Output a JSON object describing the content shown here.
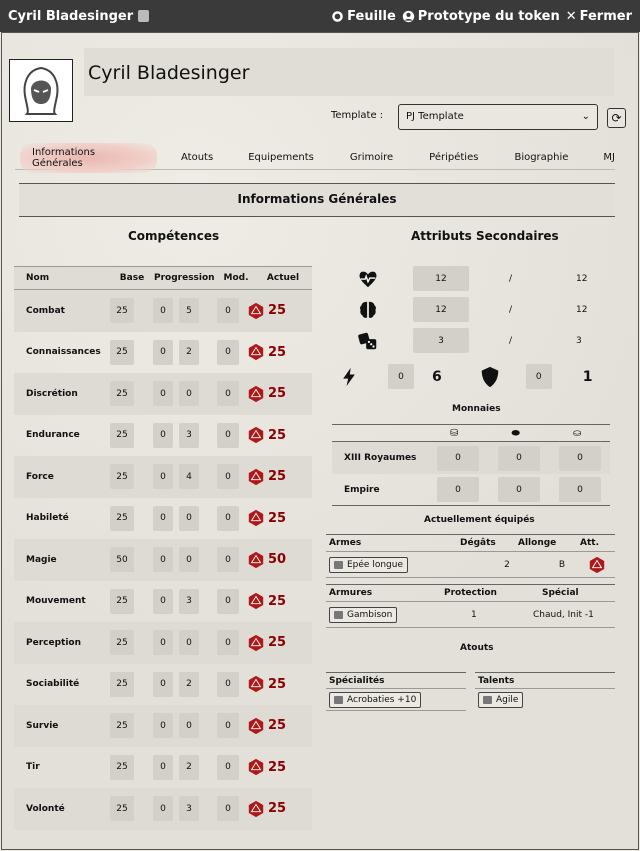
{
  "window": {
    "title": "Cyril Bladesinger",
    "actions": {
      "sheet": "Feuille",
      "token": "Prototype du token",
      "close": "Fermer"
    }
  },
  "character": {
    "name": "Cyril Bladesinger"
  },
  "template": {
    "label": "Template :",
    "value": "PJ Template"
  },
  "tabs": [
    "Informations Générales",
    "Atouts",
    "Equipements",
    "Grimoire",
    "Péripéties",
    "Biographie",
    "MJ"
  ],
  "section_title": "Informations Générales",
  "skills": {
    "title": "Compétences",
    "headers": {
      "name": "Nom",
      "base": "Base",
      "progression": "Progression",
      "mod": "Mod.",
      "actual": "Actuel"
    },
    "rows": [
      {
        "name": "Combat",
        "base": "25",
        "p1": "0",
        "p2": "5",
        "mod": "0",
        "actual": "25"
      },
      {
        "name": "Connaissances",
        "base": "25",
        "p1": "0",
        "p2": "2",
        "mod": "0",
        "actual": "25"
      },
      {
        "name": "Discrétion",
        "base": "25",
        "p1": "0",
        "p2": "0",
        "mod": "0",
        "actual": "25"
      },
      {
        "name": "Endurance",
        "base": "25",
        "p1": "0",
        "p2": "3",
        "mod": "0",
        "actual": "25"
      },
      {
        "name": "Force",
        "base": "25",
        "p1": "0",
        "p2": "4",
        "mod": "0",
        "actual": "25"
      },
      {
        "name": "Habileté",
        "base": "25",
        "p1": "0",
        "p2": "0",
        "mod": "0",
        "actual": "25"
      },
      {
        "name": "Magie",
        "base": "50",
        "p1": "0",
        "p2": "0",
        "mod": "0",
        "actual": "50"
      },
      {
        "name": "Mouvement",
        "base": "25",
        "p1": "0",
        "p2": "3",
        "mod": "0",
        "actual": "25"
      },
      {
        "name": "Perception",
        "base": "25",
        "p1": "0",
        "p2": "0",
        "mod": "0",
        "actual": "25"
      },
      {
        "name": "Sociabilité",
        "base": "25",
        "p1": "0",
        "p2": "2",
        "mod": "0",
        "actual": "25"
      },
      {
        "name": "Survie",
        "base": "25",
        "p1": "0",
        "p2": "0",
        "mod": "0",
        "actual": "25"
      },
      {
        "name": "Tir",
        "base": "25",
        "p1": "0",
        "p2": "2",
        "mod": "0",
        "actual": "25"
      },
      {
        "name": "Volonté",
        "base": "25",
        "p1": "0",
        "p2": "3",
        "mod": "0",
        "actual": "25"
      }
    ]
  },
  "secondary": {
    "title": "Attributs Secondaires",
    "rows": [
      {
        "icon": "heartbeat-icon",
        "current": "12",
        "sep": "/",
        "max": "12"
      },
      {
        "icon": "brain-icon",
        "current": "12",
        "sep": "/",
        "max": "12"
      },
      {
        "icon": "dice-icon",
        "current": "3",
        "sep": "/",
        "max": "3"
      }
    ],
    "initiative": {
      "mod": "0",
      "value": "6"
    },
    "armor": {
      "mod": "0",
      "value": "1"
    }
  },
  "money": {
    "title": "Monnaies",
    "rows": [
      {
        "name": "XIII Royaumes",
        "gold": "0",
        "silver": "0",
        "copper": "0"
      },
      {
        "name": "Empire",
        "gold": "0",
        "silver": "0",
        "copper": "0"
      }
    ]
  },
  "equipped": {
    "title": "Actuellement équipés",
    "weapons_headers": {
      "name": "Armes",
      "damage": "Dégâts",
      "reach": "Allonge",
      "att": "Att."
    },
    "weapon": {
      "name": "Epée longue",
      "damage": "2",
      "reach": "B"
    },
    "armor_headers": {
      "name": "Armures",
      "protection": "Protection",
      "special": "Spécial"
    },
    "armor": {
      "name": "Gambison",
      "protection": "1",
      "special": "Chaud, Init -1"
    }
  },
  "assets": {
    "title": "Atouts",
    "specialties_label": "Spécialités",
    "specialty": "Acrobaties +10",
    "talents_label": "Talents",
    "talent": "Agile"
  }
}
